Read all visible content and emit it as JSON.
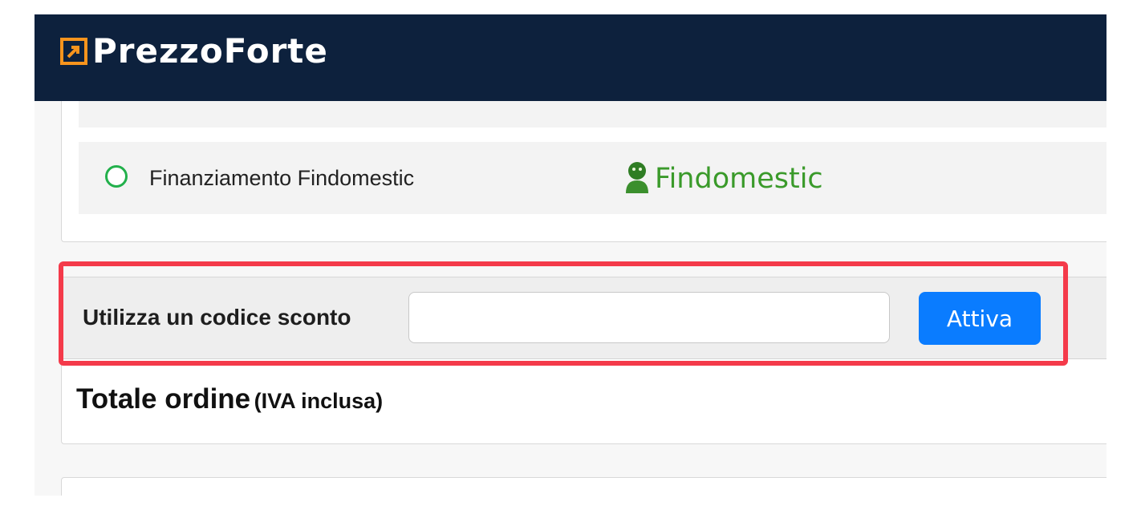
{
  "header": {
    "brand_name": "PrezzoForte",
    "background_color": "#0d213d",
    "accent_color": "#f7941d",
    "logo_icon": "arrow-box-icon"
  },
  "payment_methods": [
    {
      "label": "",
      "selected": false,
      "logo_icon": "pink-payment-logo",
      "logo_color": "#ffb3c8"
    },
    {
      "label": "Finanziamento Findomestic",
      "selected": false,
      "logo_text": "Findomestic",
      "logo_icon": "findomestic-mascot-icon",
      "logo_color": "#3a9a2a"
    }
  ],
  "discount": {
    "label": "Utilizza un codice sconto",
    "input_value": "",
    "input_placeholder": "",
    "button_label": "Attiva",
    "button_color": "#0a7cff",
    "highlight_color": "#f43a4a"
  },
  "order_total": {
    "title": "Totale ordine",
    "subtitle": "(IVA inclusa)"
  }
}
